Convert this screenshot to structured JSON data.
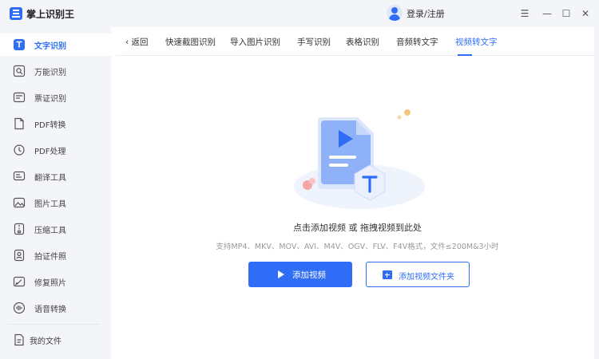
{
  "app": {
    "title": "掌上识别王"
  },
  "header": {
    "login_label": "登录/注册"
  },
  "window_controls": {
    "menu": "☰",
    "minimize": "—",
    "maximize": "☐",
    "close": "✕"
  },
  "sidebar": {
    "items": [
      {
        "label": "文字识别",
        "icon": "text-recognition-icon",
        "active": true
      },
      {
        "label": "万能识别",
        "icon": "universal-recognition-icon"
      },
      {
        "label": "票证识别",
        "icon": "ticket-recognition-icon"
      },
      {
        "label": "PDF转换",
        "icon": "pdf-convert-icon"
      },
      {
        "label": "PDF处理",
        "icon": "pdf-process-icon"
      },
      {
        "label": "翻译工具",
        "icon": "translate-icon"
      },
      {
        "label": "图片工具",
        "icon": "image-tools-icon"
      },
      {
        "label": "压缩工具",
        "icon": "compress-icon"
      },
      {
        "label": "拍证件照",
        "icon": "id-photo-icon"
      },
      {
        "label": "修复照片",
        "icon": "photo-repair-icon"
      },
      {
        "label": "语音转换",
        "icon": "voice-convert-icon"
      }
    ],
    "my_files": "我的文件"
  },
  "tabs": {
    "back": "返回",
    "items": [
      {
        "label": "快速截图识别"
      },
      {
        "label": "导入图片识别"
      },
      {
        "label": "手写识别"
      },
      {
        "label": "表格识别"
      },
      {
        "label": "音频转文字"
      },
      {
        "label": "视频转文字",
        "active": true
      }
    ]
  },
  "main": {
    "drop_text": "点击添加视频 或 拖拽视频到此处",
    "format_hint": "支持MP4、MKV、MOV、AVI、M4V、OGV、FLV、F4V格式，文件≤200M&3小时",
    "add_video_button": "添加视频",
    "add_folder_button": "添加视频文件夹"
  },
  "colors": {
    "accent": "#2f6df6",
    "sidebar_bg": "#f3f5f9"
  }
}
